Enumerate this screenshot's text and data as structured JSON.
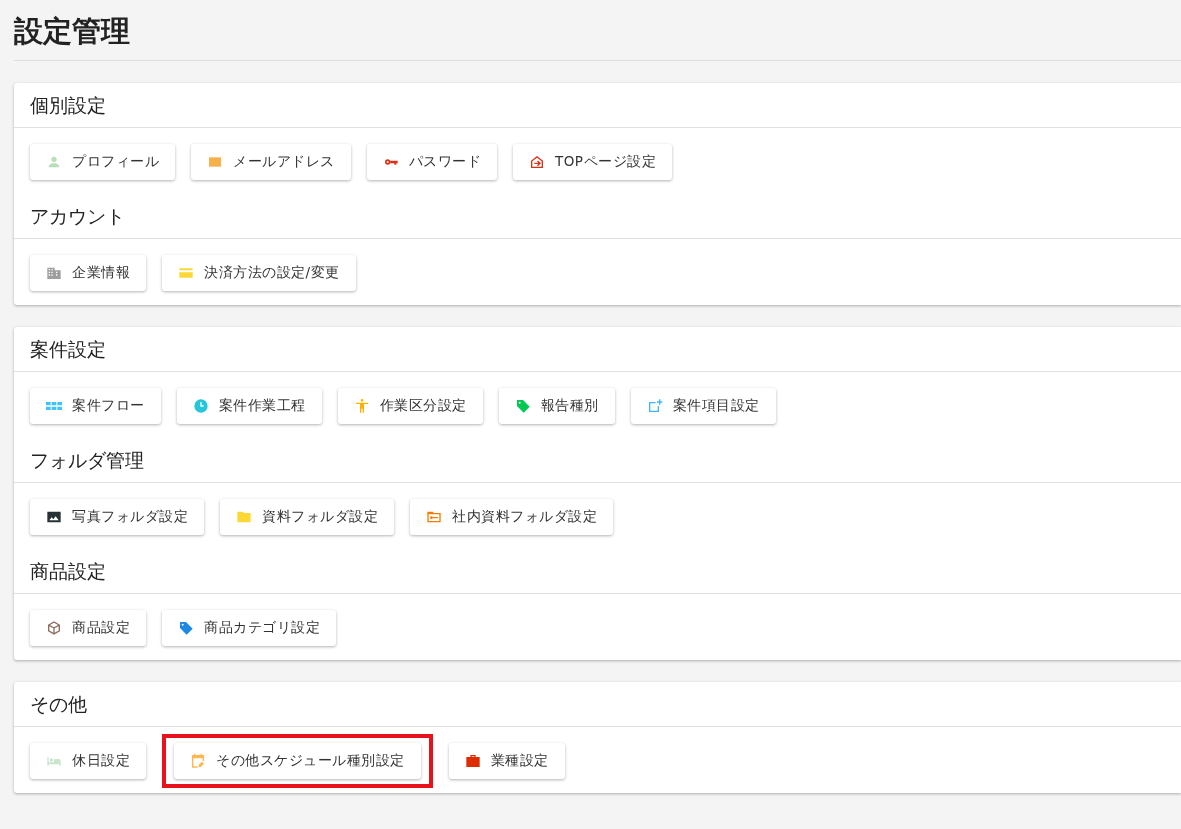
{
  "page_title": "設定管理",
  "cards": [
    {
      "sections": [
        {
          "title": "個別設定",
          "buttons": [
            {
              "label": "プロフィール",
              "kind": "person",
              "color": "#b9dfb9",
              "highlighted": false
            },
            {
              "label": "メールアドレス",
              "kind": "mail",
              "color": "#f7b04a",
              "highlighted": false
            },
            {
              "label": "パスワード",
              "kind": "key",
              "color": "#d93016",
              "highlighted": false
            },
            {
              "label": "TOPページ設定",
              "kind": "home",
              "color": "#d93016",
              "highlighted": false
            }
          ]
        },
        {
          "title": "アカウント",
          "buttons": [
            {
              "label": "企業情報",
              "kind": "building",
              "color": "#9e9e9e",
              "highlighted": false
            },
            {
              "label": "決済方法の設定/変更",
              "kind": "card",
              "color": "#fdd835",
              "highlighted": false
            }
          ]
        }
      ]
    },
    {
      "sections": [
        {
          "title": "案件設定",
          "buttons": [
            {
              "label": "案件フロー",
              "kind": "flow",
              "color": "#40c4ff",
              "highlighted": false
            },
            {
              "label": "案件作業工程",
              "kind": "clock",
              "color": "#26c6da",
              "highlighted": false
            },
            {
              "label": "作業区分設定",
              "kind": "figure",
              "color": "#ffb300",
              "highlighted": false
            },
            {
              "label": "報告種別",
              "kind": "tag",
              "color": "#00c853",
              "highlighted": false
            },
            {
              "label": "案件項目設定",
              "kind": "addbox",
              "color": "#40b4ff",
              "highlighted": false
            }
          ]
        },
        {
          "title": "フォルダ管理",
          "buttons": [
            {
              "label": "写真フォルダ設定",
              "kind": "image",
              "color": "#263238",
              "highlighted": false
            },
            {
              "label": "資料フォルダ設定",
              "kind": "folder",
              "color": "#fdd835",
              "highlighted": false
            },
            {
              "label": "社内資料フォルダ設定",
              "kind": "folderkey",
              "color": "#f57c00",
              "highlighted": false
            }
          ]
        },
        {
          "title": "商品設定",
          "buttons": [
            {
              "label": "商品設定",
              "kind": "box",
              "color": "#8d6e63",
              "highlighted": false
            },
            {
              "label": "商品カテゴリ設定",
              "kind": "tag",
              "color": "#1e88e5",
              "highlighted": false
            }
          ]
        }
      ]
    },
    {
      "sections": [
        {
          "title": "その他",
          "buttons": [
            {
              "label": "休日設定",
              "kind": "bed",
              "color": "#c8e6c9",
              "highlighted": false
            },
            {
              "label": "その他スケジュール種別設定",
              "kind": "calendar",
              "color": "#ffb74d",
              "highlighted": true
            },
            {
              "label": "業種設定",
              "kind": "briefcase",
              "color": "#dd2c00",
              "highlighted": false
            }
          ]
        }
      ]
    }
  ]
}
